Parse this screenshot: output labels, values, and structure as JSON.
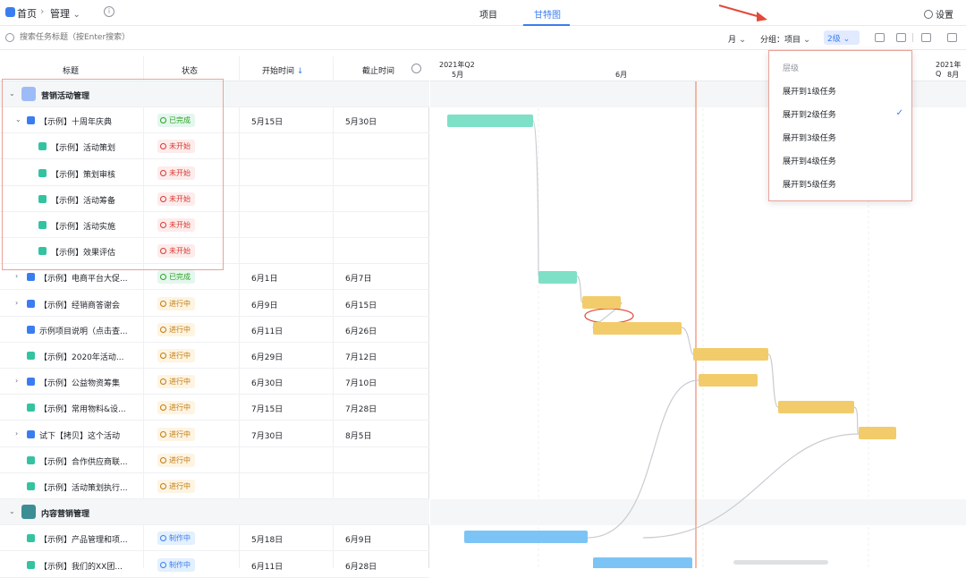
{
  "header": {
    "breadcrumb_home": "首页",
    "breadcrumb_current": "管理",
    "tabs": [
      {
        "label": "项目"
      },
      {
        "label": "甘特图"
      }
    ],
    "settings_label": "设置"
  },
  "toolbar": {
    "search_placeholder": "搜索任务标题（按Enter搜索）",
    "view": "月",
    "group_label": "分组：项目",
    "level": "2级"
  },
  "grid": {
    "columns": {
      "title": "标题",
      "status": "状态",
      "start": "开始时间",
      "end": "截止时间"
    },
    "rows": [
      {
        "type": "group",
        "title": "营销活动管理"
      },
      {
        "type": "task",
        "title": "【示例】十周年庆典",
        "status": "已完成",
        "start": "5月15日",
        "end": "5月30日"
      },
      {
        "type": "task",
        "title": "【示例】活动策划",
        "status": "未开始",
        "start": "",
        "end": ""
      },
      {
        "type": "task",
        "title": "【示例】策划审核",
        "status": "未开始",
        "start": "",
        "end": ""
      },
      {
        "type": "task",
        "title": "【示例】活动筹备",
        "status": "未开始",
        "start": "",
        "end": ""
      },
      {
        "type": "task",
        "title": "【示例】活动实施",
        "status": "未开始",
        "start": "",
        "end": ""
      },
      {
        "type": "task",
        "title": "【示例】效果评估",
        "status": "未开始",
        "start": "",
        "end": ""
      },
      {
        "type": "task",
        "title": "【示例】电商平台大促...",
        "status": "已完成",
        "start": "6月1日",
        "end": "6月7日"
      },
      {
        "type": "task",
        "title": "【示例】经销商答谢会",
        "status": "进行中",
        "start": "6月9日",
        "end": "6月15日"
      },
      {
        "type": "task",
        "title": "示例项目说明（点击查...",
        "status": "进行中",
        "start": "6月11日",
        "end": "6月26日"
      },
      {
        "type": "task",
        "title": "【示例】2020年活动...",
        "status": "进行中",
        "start": "6月29日",
        "end": "7月12日"
      },
      {
        "type": "task",
        "title": "【示例】公益物资筹集",
        "status": "进行中",
        "start": "6月30日",
        "end": "7月10日"
      },
      {
        "type": "task",
        "title": "【示例】常用物料&设...",
        "status": "进行中",
        "start": "7月15日",
        "end": "7月28日"
      },
      {
        "type": "task",
        "title": "试下【拷贝】这个活动",
        "status": "进行中",
        "start": "7月30日",
        "end": "8月5日"
      },
      {
        "type": "task",
        "title": "【示例】合作供应商联...",
        "status": "进行中",
        "start": "",
        "end": ""
      },
      {
        "type": "task",
        "title": "【示例】活动策划执行...",
        "status": "进行中",
        "start": "",
        "end": ""
      },
      {
        "type": "group",
        "title": "内容营销管理"
      },
      {
        "type": "task",
        "title": "【示例】产品管理和项...",
        "status": "制作中",
        "start": "5月18日",
        "end": "6月9日"
      },
      {
        "type": "task",
        "title": "【示例】我们的XX团...",
        "status": "制作中",
        "start": "6月11日",
        "end": "6月28日"
      }
    ]
  },
  "timeline": {
    "quarter_left": "2021年Q2",
    "quarter_right": "2021年Q",
    "months": [
      "5月",
      "6月",
      "8月"
    ]
  },
  "level_menu": {
    "header": "层级",
    "items": [
      "展开到1级任务",
      "展开到2级任务",
      "展开到3级任务",
      "展开到4级任务",
      "展开到5级任务"
    ],
    "selected_index": 1
  },
  "colors": {
    "accent": "#3a7df0",
    "bar_done": "#7ee0c6",
    "bar_doing": "#f2cc6b",
    "bar_make": "#7cc4f5",
    "today_line": "#f0a28a",
    "annotation": "#e8a39a"
  }
}
